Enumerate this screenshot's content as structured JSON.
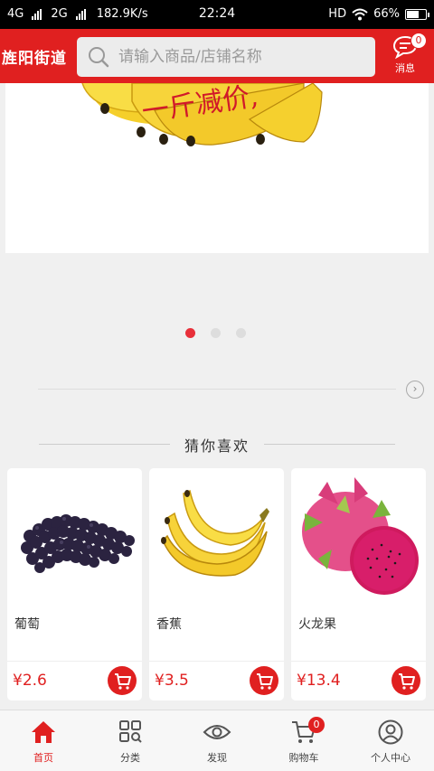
{
  "status_bar": {
    "network1": "4G",
    "network2": "2G",
    "speed": "182.9K/s",
    "time": "22:24",
    "hd": "HD",
    "battery": "66%",
    "battery_level": 0.66
  },
  "header": {
    "location": "旌阳街道",
    "search_placeholder": "请输入商品/店铺名称",
    "message_label": "消息",
    "message_count": "0"
  },
  "banner": {
    "overlay_text": "一斤减价,",
    "slide_count": 3,
    "active_slide": 1
  },
  "section": {
    "title": "猜你喜欢"
  },
  "products": [
    {
      "name": "葡萄",
      "price": "¥2.6",
      "image": "grapes"
    },
    {
      "name": "香蕉",
      "price": "¥3.5",
      "image": "banana"
    },
    {
      "name": "火龙果",
      "price": "¥13.4",
      "image": "dragon-fruit"
    }
  ],
  "bottom_nav": {
    "items": [
      {
        "label": "首页",
        "icon": "home-icon",
        "active": true
      },
      {
        "label": "分类",
        "icon": "category-icon"
      },
      {
        "label": "发现",
        "icon": "eye-icon"
      },
      {
        "label": "购物车",
        "icon": "cart-icon",
        "badge": "0"
      },
      {
        "label": "个人中心",
        "icon": "user-icon"
      }
    ]
  },
  "colors": {
    "brand": "#e02020",
    "background": "#f0f0f0"
  }
}
